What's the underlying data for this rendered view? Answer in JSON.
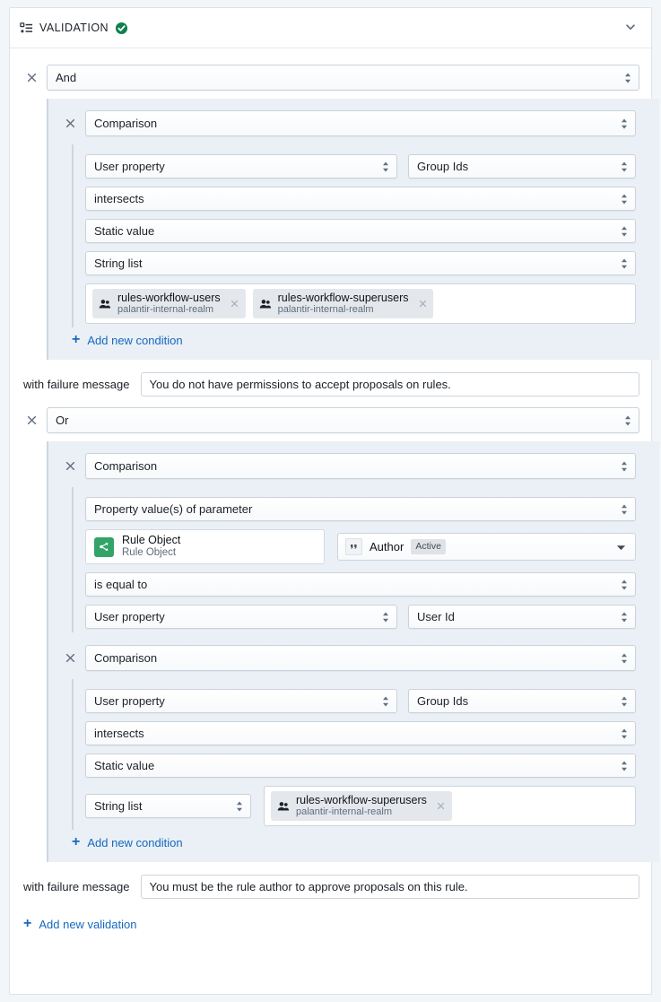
{
  "header": {
    "title": "VALIDATION",
    "icon": "properties-icon",
    "status_icon": "check-circle-icon",
    "status_color": "#0f8050",
    "collapse_icon": "chevron-down-icon"
  },
  "colors": {
    "accent_link": "#1668c1",
    "panel_bg": "#eaf0f5",
    "card_bg": "#ffffff",
    "object_icon_bg": "#32a467",
    "chip_bg": "#e4e8ed"
  },
  "labels": {
    "failure_message_label": "with failure message",
    "add_condition": "Add new condition",
    "add_validation": "Add new validation",
    "remove_icon": "close-icon",
    "plus_icon": "plus-icon"
  },
  "validations": [
    {
      "operator": "And",
      "failure_message": "You do not have permissions to accept proposals on rules.",
      "conditions": [
        {
          "type": "Comparison",
          "left_source": "User property",
          "left_value": "Group Ids",
          "operator": "intersects",
          "right_source": "Static value",
          "right_type": "String list",
          "chips": [
            {
              "name": "rules-workflow-users",
              "realm": "palantir-internal-realm",
              "icon": "group-icon"
            },
            {
              "name": "rules-workflow-superusers",
              "realm": "palantir-internal-realm",
              "icon": "group-icon"
            }
          ]
        }
      ]
    },
    {
      "operator": "Or",
      "failure_message": "You must be the rule author to approve proposals on this rule.",
      "conditions": [
        {
          "type": "Comparison",
          "left_source": "Property value(s) of parameter",
          "object": {
            "name": "Rule Object",
            "subtitle": "Rule Object",
            "icon": "object-flow-icon"
          },
          "property": {
            "icon": "quote-icon",
            "name": "Author",
            "badge": "Active",
            "caret": "triangle-down-icon"
          },
          "operator": "is equal to",
          "right_source": "User property",
          "right_value": "User Id"
        },
        {
          "type": "Comparison",
          "left_source": "User property",
          "left_value": "Group Ids",
          "operator": "intersects",
          "right_source": "Static value",
          "right_type": "String list",
          "chips": [
            {
              "name": "rules-workflow-superusers",
              "realm": "palantir-internal-realm",
              "icon": "group-icon"
            }
          ]
        }
      ]
    }
  ]
}
